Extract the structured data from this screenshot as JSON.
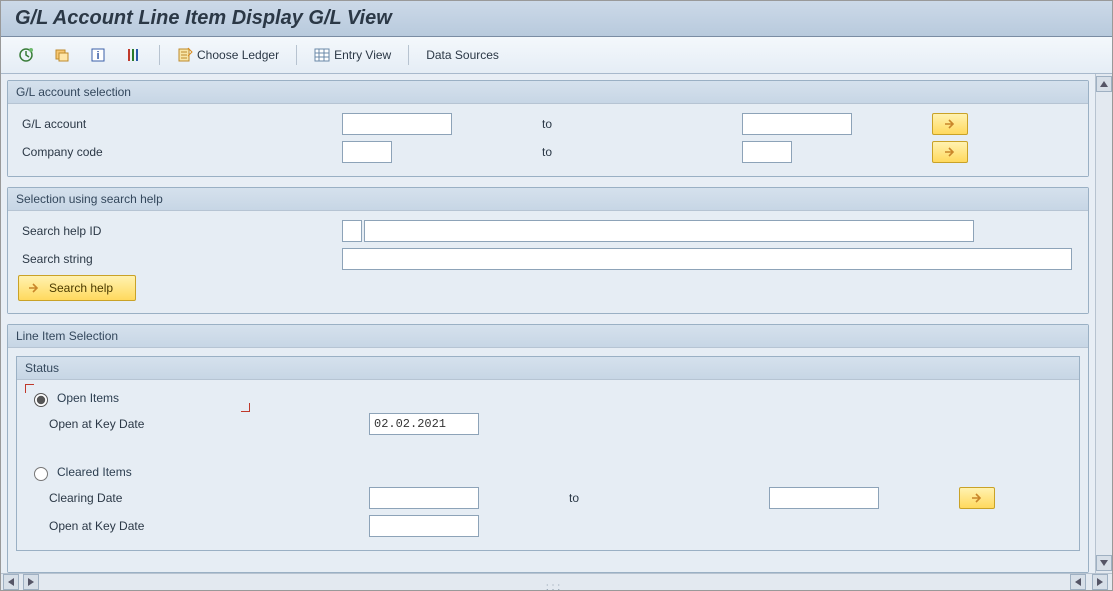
{
  "title": "G/L Account Line Item Display G/L View",
  "toolbar": {
    "choose_ledger": "Choose Ledger",
    "entry_view": "Entry View",
    "data_sources": "Data Sources"
  },
  "gl_selection": {
    "title": "G/L account selection",
    "account_label": "G/L account",
    "account_from": "",
    "account_to": "",
    "to_label": "to",
    "company_label": "Company code",
    "company_from": "",
    "company_to": ""
  },
  "search_help": {
    "title": "Selection using search help",
    "id_label": "Search help ID",
    "id_value": "",
    "id_desc": "",
    "string_label": "Search string",
    "string_value": "",
    "button": "Search help"
  },
  "line_item": {
    "title": "Line Item Selection",
    "status_title": "Status",
    "open_items": "Open Items",
    "open_key_date_label": "Open at Key Date",
    "open_key_date_value": "02.02.2021",
    "cleared_items": "Cleared Items",
    "clearing_date_label": "Clearing Date",
    "clearing_to_label": "to",
    "clearing_from": "",
    "clearing_to": "",
    "cleared_key_date_label": "Open at Key Date",
    "cleared_key_date_value": "",
    "selected_status": "open"
  }
}
